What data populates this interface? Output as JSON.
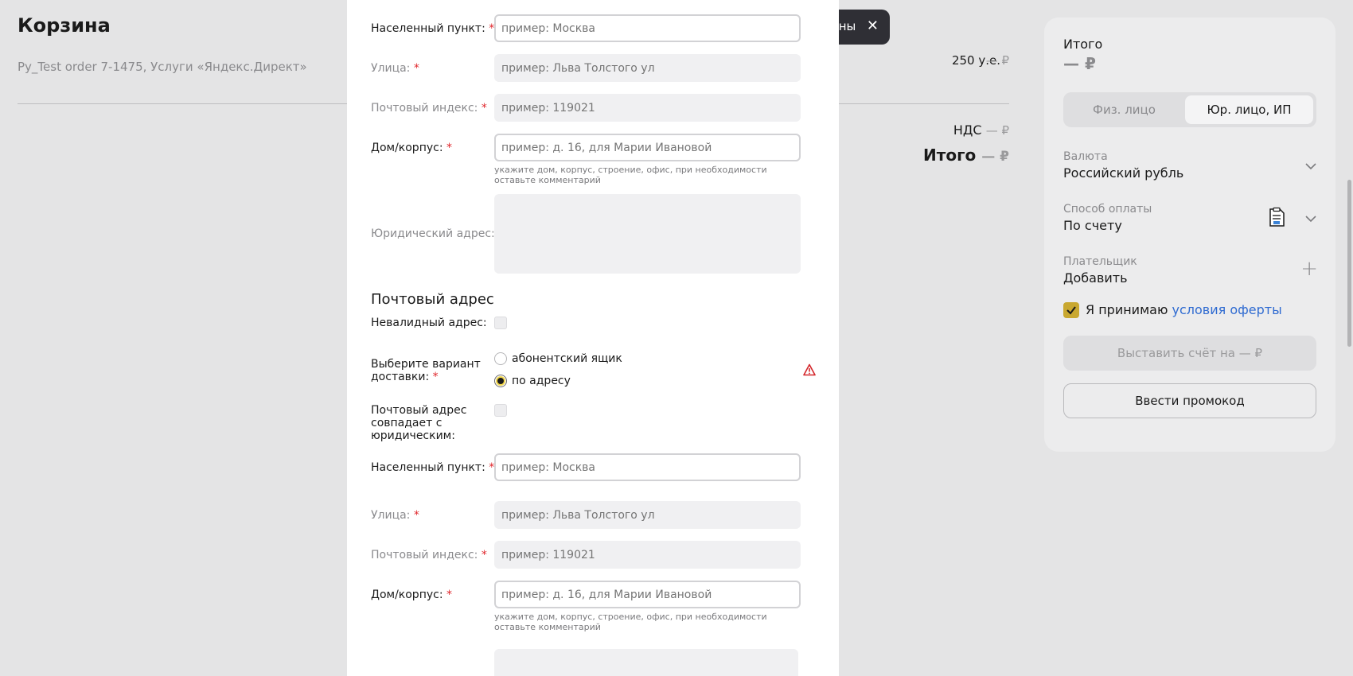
{
  "background": {
    "title": "Корзина",
    "order_line": "Py_Test order 7-1475, Услуги «Яндекс.Директ»",
    "amount": "250 у.е.",
    "amount_rub": "— ₽",
    "vat_label": "НДС",
    "vat_value": "— ₽",
    "total_label": "Итого",
    "total_value": "— ₽"
  },
  "toast": {
    "text": "ины",
    "close": "✕"
  },
  "summary": {
    "total_label": "Итого",
    "total_value": "— ₽",
    "person_tabs": [
      "Физ. лицо",
      "Юр. лицо, ИП"
    ],
    "selected_tab": "Юр. лицо, ИП",
    "currency_label": "Валюта",
    "currency_value": "Российский рубль",
    "payment_label": "Способ оплаты",
    "payment_value": "По счету",
    "payer_label": "Плательщик",
    "payer_value": "Добавить",
    "accept_text": "Я принимаю ",
    "accept_link": "условия оферты",
    "accept_checked": true,
    "invoice_button": "Выставить счёт на — ₽",
    "promo_button": "Ввести промокод"
  },
  "form": {
    "legal": {
      "city_label": "Населенный пункт:",
      "city_placeholder": "пример: Москва",
      "street_label": "Улица:",
      "street_placeholder": "пример: Льва Толстого ул",
      "zip_label": "Почтовый индекс:",
      "zip_placeholder": "пример: 119021",
      "house_label": "Дом/корпус:",
      "house_placeholder": "пример: д. 16, для Марии Ивановой",
      "house_hint": "укажите дом, корпус, строение, офис, при необходимости оставьте комментарий",
      "legal_address_label": "Юридический адрес:"
    },
    "postal_section_title": "Почтовый адрес",
    "invalid_address_label": "Невалидный адрес:",
    "delivery_label": "Выберите вариант доставки:",
    "delivery_options": [
      "абонентский ящик",
      "по адресу"
    ],
    "delivery_selected": "по адресу",
    "same_as_legal_label": "Почтовый адрес совпадает с юридическим:",
    "postal": {
      "city_label": "Населенный пункт:",
      "city_placeholder": "пример: Москва",
      "street_label": "Улица:",
      "street_placeholder": "пример: Льва Толстого ул",
      "zip_label": "Почтовый индекс:",
      "zip_placeholder": "пример: 119021",
      "house_label": "Дом/корпус:",
      "house_placeholder": "пример: д. 16, для Марии Ивановой",
      "house_hint": "укажите дом, корпус, строение, офис, при необходимости оставьте комментарий"
    },
    "required_mark": "*"
  },
  "colors": {
    "accent_yellow": "#c9a830",
    "link_blue": "#2f6bd1",
    "required_red": "#e0262b",
    "warning_red": "#d3262a"
  }
}
